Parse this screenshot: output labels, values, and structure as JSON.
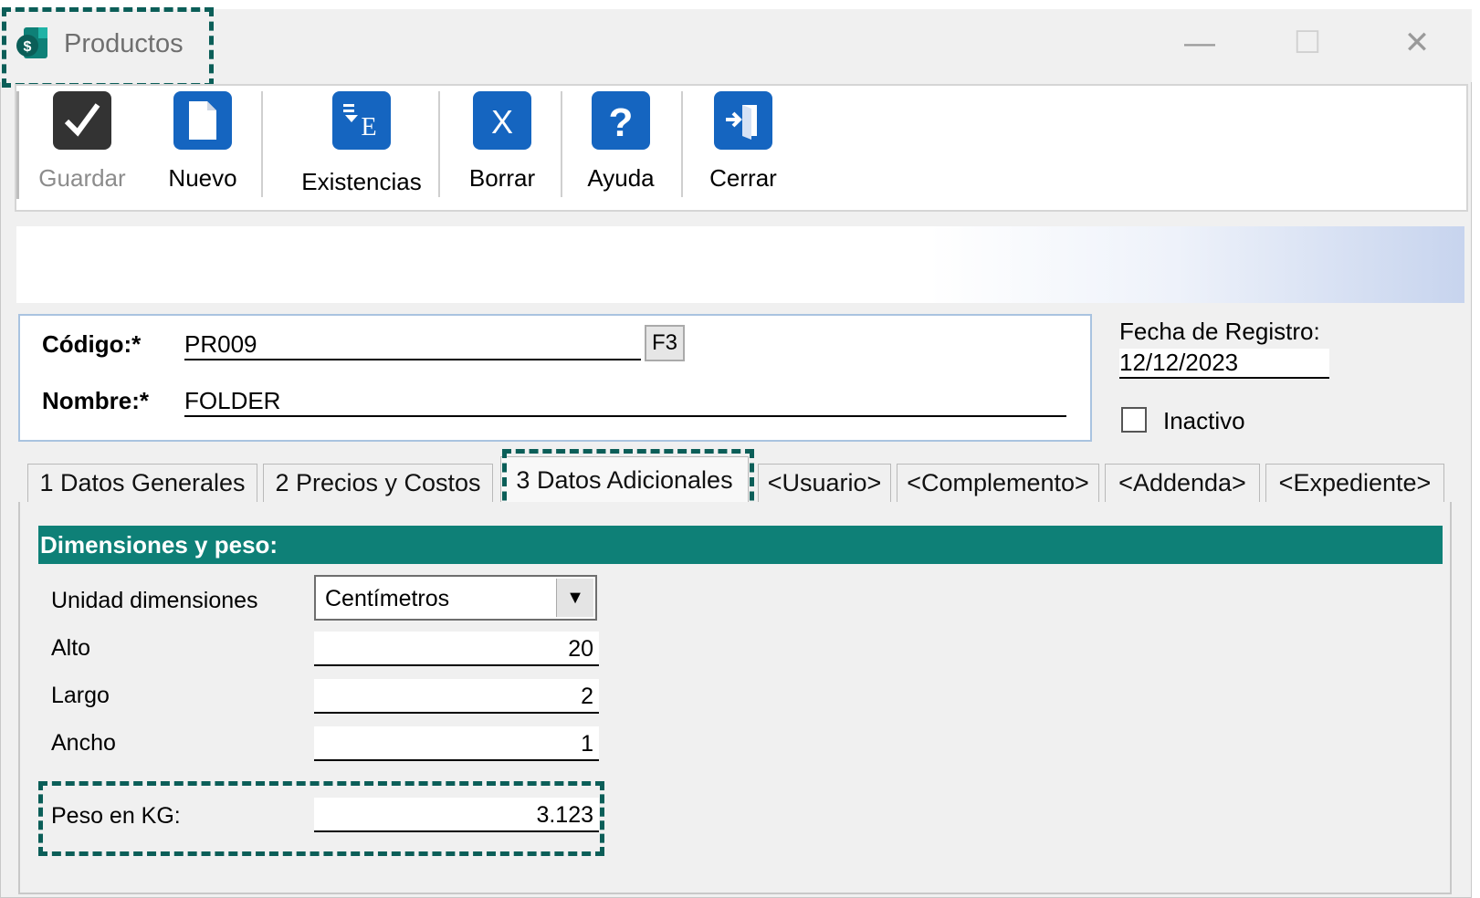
{
  "window": {
    "title": "Productos",
    "controls": {
      "minimize": "—",
      "maximize": "☐",
      "close": "✕"
    }
  },
  "toolbar": {
    "buttons": [
      {
        "label": "Guardar",
        "icon": "check-icon",
        "enabled": false
      },
      {
        "label": "Nuevo",
        "icon": "document-icon",
        "enabled": true
      },
      {
        "label": "Existencias",
        "icon": "inventory-icon",
        "enabled": true
      },
      {
        "label": "Borrar",
        "icon": "delete-x-icon",
        "enabled": true
      },
      {
        "label": "Ayuda",
        "icon": "help-icon",
        "enabled": true
      },
      {
        "label": "Cerrar",
        "icon": "exit-door-icon",
        "enabled": true
      }
    ]
  },
  "header": {
    "codigo_label": "Código:*",
    "codigo_value": "PR009",
    "f3_label": "F3",
    "nombre_label": "Nombre:*",
    "nombre_value": "FOLDER",
    "fecha_label": "Fecha de Registro:",
    "fecha_value": "12/12/2023",
    "inactivo_label": "Inactivo",
    "inactivo_checked": false
  },
  "tabs": [
    {
      "label": "1 Datos Generales",
      "active": false
    },
    {
      "label": "2 Precios y Costos",
      "active": false
    },
    {
      "label": "3 Datos Adicionales",
      "active": true
    },
    {
      "label": "<Usuario>",
      "active": false
    },
    {
      "label": "<Complemento>",
      "active": false
    },
    {
      "label": "<Addenda>",
      "active": false
    },
    {
      "label": "<Expediente>",
      "active": false
    }
  ],
  "section": {
    "title": "Dimensiones y peso:",
    "unidad_label": "Unidad dimensiones",
    "unidad_value": "Centímetros",
    "alto_label": "Alto",
    "alto_value": "20",
    "largo_label": "Largo",
    "largo_value": "2",
    "ancho_label": "Ancho",
    "ancho_value": "1",
    "peso_label": "Peso en KG:",
    "peso_value": "3.123"
  },
  "colors": {
    "section_header": "#0e8077",
    "highlight_dash": "#0b5e58",
    "toolbar_icon_blue": "#1565c0",
    "disabled_icon": "#333333"
  }
}
